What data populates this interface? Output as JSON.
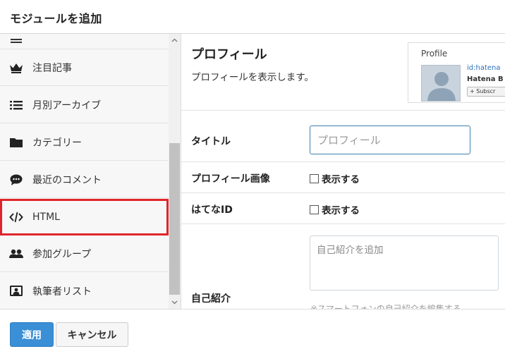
{
  "dialog": {
    "title": "モジュールを追加"
  },
  "sidebar": {
    "items": [
      {
        "label": "注目記事",
        "icon": "crown-icon"
      },
      {
        "label": "月別アーカイブ",
        "icon": "list-icon"
      },
      {
        "label": "カテゴリー",
        "icon": "folder-icon"
      },
      {
        "label": "最近のコメント",
        "icon": "comment-icon"
      },
      {
        "label": "HTML",
        "icon": "code-icon"
      },
      {
        "label": "参加グループ",
        "icon": "group-icon"
      },
      {
        "label": "執筆者リスト",
        "icon": "author-card-icon"
      }
    ],
    "active_index": 4
  },
  "module": {
    "title": "プロフィール",
    "description": "プロフィールを表示します。",
    "preview": {
      "title": "Profile",
      "user_id": "id:hatena",
      "user_name": "Hatena B",
      "subscribe_label": "+ Subscr"
    }
  },
  "form": {
    "title_label": "タイトル",
    "title_placeholder": "プロフィール",
    "image_label": "プロフィール画像",
    "image_checkbox": "表示する",
    "hatena_id_label": "はてなID",
    "hatena_id_checkbox": "表示する",
    "bio_label": "自己紹介",
    "bio_placeholder": "自己紹介を追加",
    "bio_note": "※スマートフォンの自己紹介を編集する"
  },
  "footer": {
    "apply_label": "適用",
    "cancel_label": "キャンセル"
  },
  "colors": {
    "accent": "#3a8fd6",
    "highlight": "#e0242b"
  }
}
